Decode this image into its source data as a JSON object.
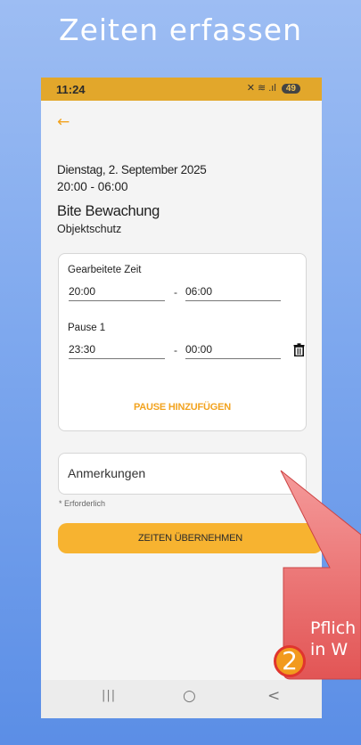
{
  "banner": {
    "title": "Zeiten erfassen"
  },
  "statusbar": {
    "time": "11:24",
    "icons": "✕ ≋ .ıl",
    "battery": "49"
  },
  "nav_icons": {
    "back": "arrow-left-icon"
  },
  "shift": {
    "date": "Dienstag, 2. September 2025",
    "range": "20:00 - 06:00",
    "client": "Bite Bewachung",
    "service": "Objektschutz"
  },
  "worked": {
    "label": "Gearbeitete Zeit",
    "start": "20:00",
    "separator": "-",
    "end": "06:00"
  },
  "pause1": {
    "label": "Pause 1",
    "start": "23:30",
    "separator": "-",
    "end": "00:00"
  },
  "add_pause_label": "PAUSE HINZUFÜGEN",
  "remarks": {
    "placeholder": "Anmerkungen",
    "required_note": "* Erforderlich"
  },
  "submit_label": "ZEITEN ÜBERNEHMEN",
  "android_nav": {
    "recent": "|||",
    "home": "○",
    "back": "<"
  },
  "callout": {
    "line1": "Pflich",
    "line2": "in W",
    "badge": "2"
  },
  "colors": {
    "accent": "#f2a31f",
    "statusbar": "#e2a72b",
    "callout": "#e25555"
  }
}
